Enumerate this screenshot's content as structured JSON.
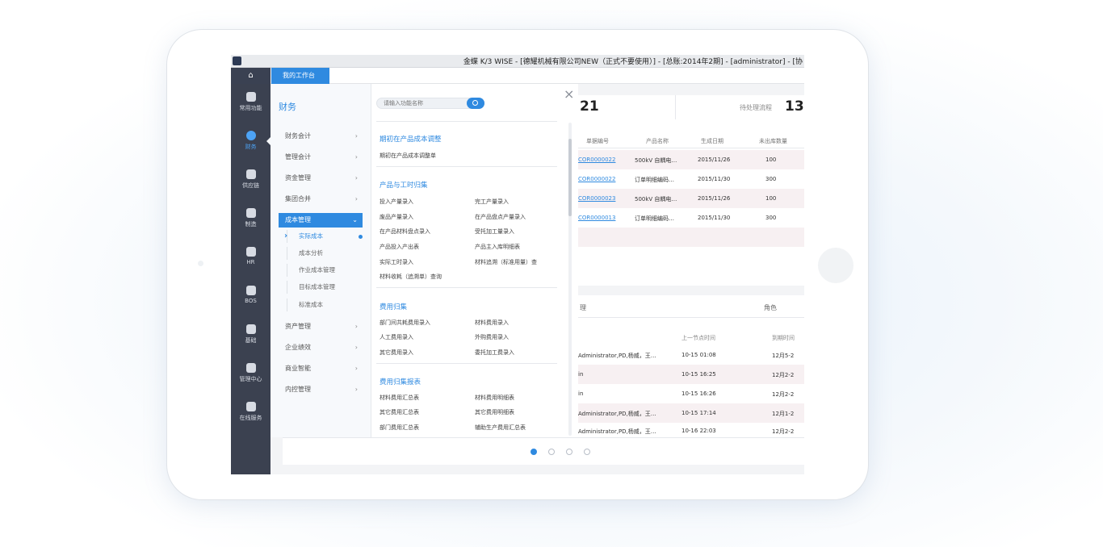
{
  "window": {
    "title": "金蝶 K/3 WISE - [德耀机械有限公司NEW（正式不要使用）] - [总账:2014年2期] - [administrator] - [协"
  },
  "tabs": {
    "home_label": "⌂",
    "active_label": "我的工作台"
  },
  "leftnav": [
    {
      "label": "常用功能",
      "icon": "bookmark-icon"
    },
    {
      "label": "财务",
      "icon": "finance-icon"
    },
    {
      "label": "供应链",
      "icon": "database-icon"
    },
    {
      "label": "制造",
      "icon": "gear-icon"
    },
    {
      "label": "HR",
      "icon": "org-icon"
    },
    {
      "label": "BOS",
      "icon": "grid-icon"
    },
    {
      "label": "基础",
      "icon": "settings-icon"
    },
    {
      "label": "管理中心",
      "icon": "server-icon"
    },
    {
      "label": "在线服务",
      "icon": "cloud-icon"
    }
  ],
  "category": {
    "title": "财务",
    "items": [
      "财务会计",
      "管理会计",
      "资金管理",
      "集团合并",
      "成本管理",
      "资产管理",
      "企业绩效",
      "商业智能",
      "内控管理"
    ],
    "sub_items": [
      "实际成本",
      "成本分析",
      "作业成本管理",
      "目标成本管理",
      "标准成本"
    ]
  },
  "search": {
    "placeholder": "请输入功能名称"
  },
  "close_label": "×",
  "sections": [
    {
      "title": "期初在产品成本调整",
      "items": [
        "期初在产品成本调整单"
      ]
    },
    {
      "title": "产品与工时归集",
      "items": [
        "投入产量录入",
        "完工产量录入",
        "废品产量录入",
        "在产品盘点产量录入",
        "在产品材料盘点录入",
        "受托加工量录入",
        "产品投入产出表",
        "产品主入库明细表",
        "实际工时录入",
        "材料追溯（标准用量）查",
        "材料收耗（追溯单）查询"
      ]
    },
    {
      "title": "费用归集",
      "items": [
        "部门间共耗费用录入",
        "材料费用录入",
        "人工费用录入",
        "外购费用录入",
        "其它费用录入",
        "委托加工费录入"
      ]
    },
    {
      "title": "费用归集报表",
      "items": [
        "材料费用汇总表",
        "材料费用明细表",
        "其它费用汇总表",
        "其它费用明细表",
        "部门费用汇总表",
        "辅助生产费用汇总表"
      ]
    }
  ],
  "stats": {
    "a_value": "21",
    "b_label": "待处理流程",
    "b_value": "13"
  },
  "table1": {
    "headers": [
      "单据编号",
      "产品名称",
      "生成日期",
      "未出库数量"
    ],
    "rows": [
      [
        "COR0000022",
        "500kV 自耦电…",
        "2015/11/26",
        "100"
      ],
      [
        "COR0000022",
        "订单明细编码…",
        "2015/11/30",
        "300"
      ],
      [
        "COR0000023",
        "500kV 自耦电…",
        "2015/11/26",
        "100"
      ],
      [
        "COR0000013",
        "订单明细编码…",
        "2015/11/30",
        "300"
      ]
    ]
  },
  "card2": {
    "head_left": "理",
    "head_right": "角色",
    "headers": [
      "上一节点时间",
      "到期时间"
    ],
    "rows": [
      [
        "Administrator,PD,杨威，王…",
        "10-15 01:08",
        "12月5-2"
      ],
      [
        "in",
        "10-15 16:25",
        "12月2-2"
      ],
      [
        "in",
        "10-15 16:26",
        "12月2-2"
      ],
      [
        "Administrator,PD,杨威，王…",
        "10-15 17:14",
        "12月1-2"
      ],
      [
        "Administrator,PD,杨威，王…",
        "10-16 22:03",
        "12月2-2"
      ]
    ]
  },
  "pager": {
    "count": 4,
    "active": 0
  }
}
